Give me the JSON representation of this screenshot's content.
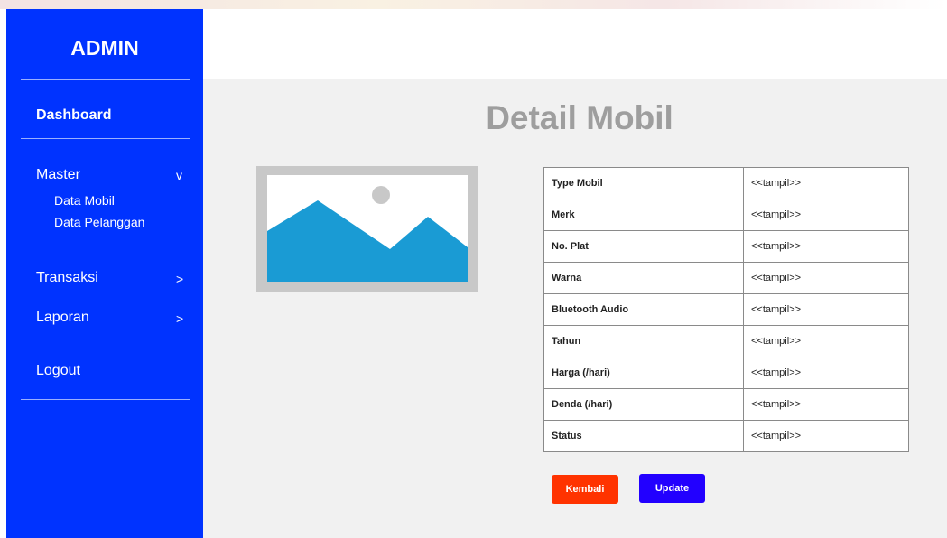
{
  "sidebar": {
    "brand": "ADMIN",
    "dashboard": "Dashboard",
    "master": {
      "label": "Master",
      "chevron": "v",
      "items": [
        "Data Mobil",
        "Data Pelanggan"
      ]
    },
    "transaksi": {
      "label": "Transaksi",
      "chevron": ">"
    },
    "laporan": {
      "label": "Laporan",
      "chevron": ">"
    },
    "logout": "Logout"
  },
  "main": {
    "title": "Detail Mobil",
    "image_icon": "image-placeholder-icon",
    "details": [
      {
        "label": "Type Mobil",
        "value": "<<tampil>>"
      },
      {
        "label": "Merk",
        "value": "<<tampil>>"
      },
      {
        "label": "No. Plat",
        "value": "<<tampil>>"
      },
      {
        "label": "Warna",
        "value": "<<tampil>>"
      },
      {
        "label": "Bluetooth Audio",
        "value": "<<tampil>>"
      },
      {
        "label": "Tahun",
        "value": "<<tampil>>"
      },
      {
        "label": "Harga (/hari)",
        "value": "<<tampil>>"
      },
      {
        "label": "Denda (/hari)",
        "value": "<<tampil>>"
      },
      {
        "label": "Status",
        "value": "<<tampil>>"
      }
    ],
    "buttons": {
      "back": "Kembali",
      "update": "Update"
    }
  },
  "colors": {
    "sidebar": "#0033ff",
    "main_bg": "#f1f1f1",
    "title": "#9e9e9e",
    "back_button": "#ff3300",
    "update_button": "#2200ff",
    "image_fill": "#1a9bd4"
  }
}
